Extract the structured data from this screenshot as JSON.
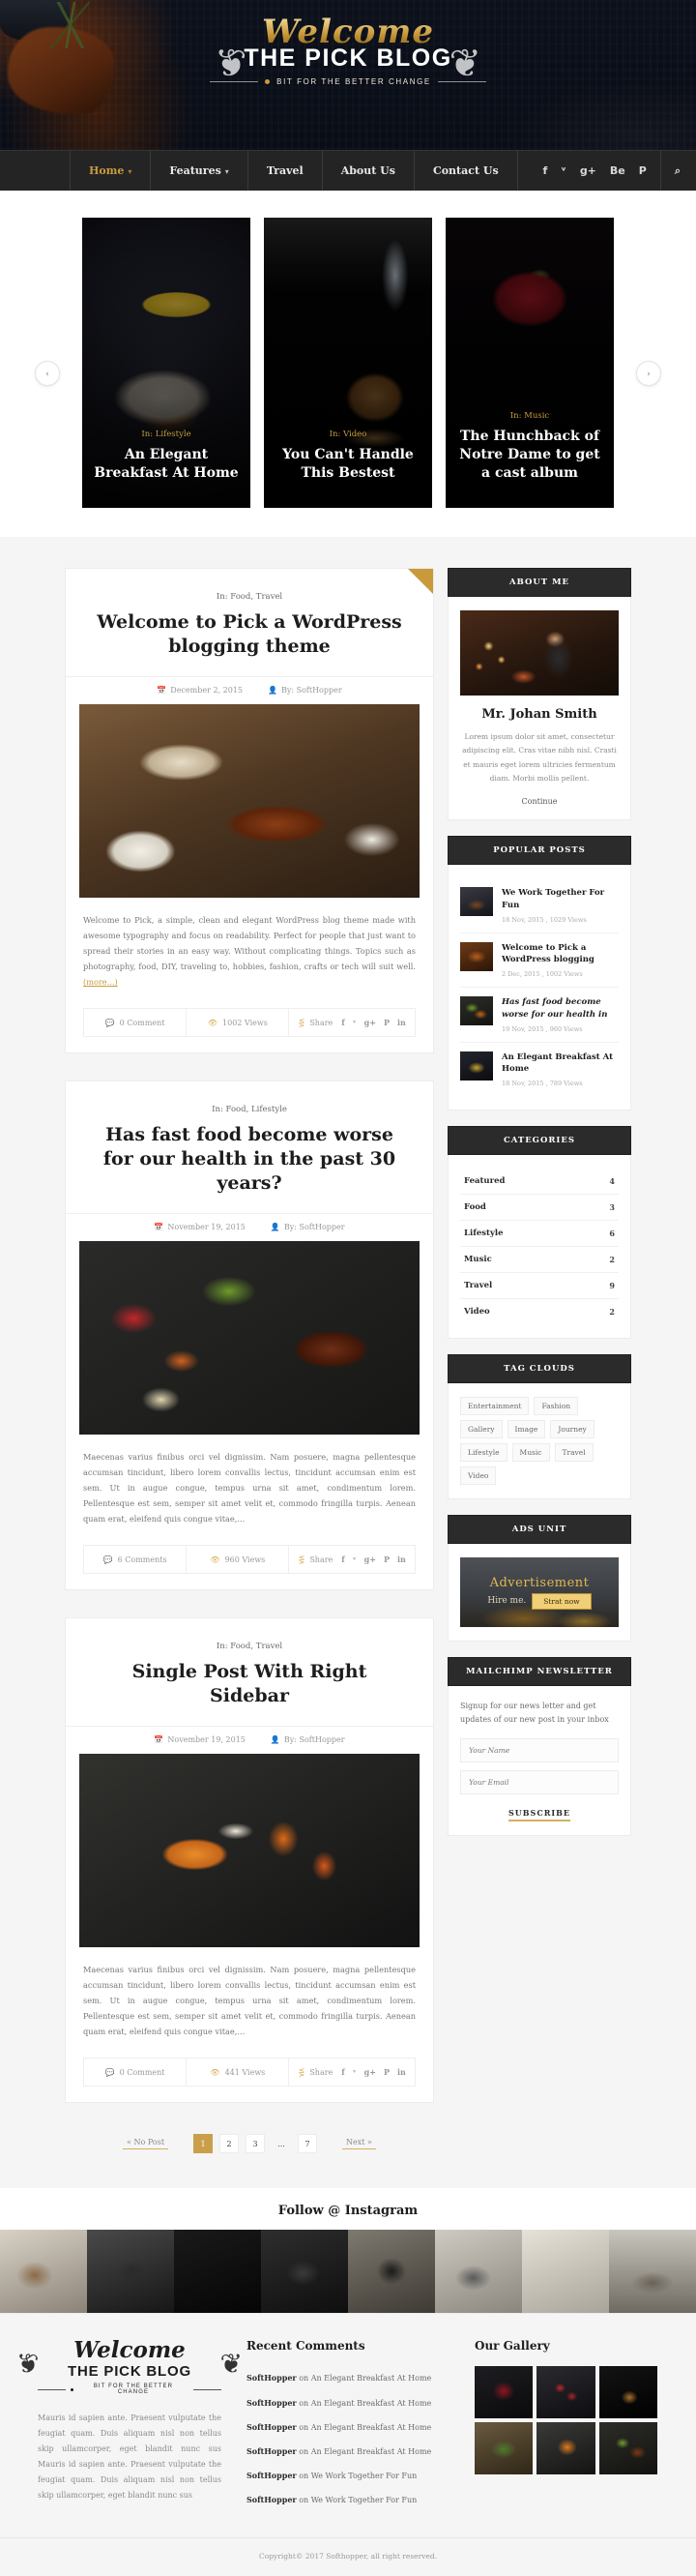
{
  "header": {
    "logo_script": "Welcome",
    "logo_main": "THE PICK BLOG",
    "logo_tagline": "BIT FOR THE BETTER CHANGE"
  },
  "nav": {
    "items": [
      {
        "label": "Home",
        "caret": "▾",
        "active": true
      },
      {
        "label": "Features",
        "caret": "▾",
        "active": false
      },
      {
        "label": "Travel",
        "caret": "",
        "active": false
      },
      {
        "label": "About Us",
        "caret": "",
        "active": false
      },
      {
        "label": "Contact Us",
        "caret": "",
        "active": false
      }
    ],
    "social": [
      {
        "name": "facebook-icon",
        "glyph": "f"
      },
      {
        "name": "twitter-icon",
        "glyph": "ᵛ"
      },
      {
        "name": "google-plus-icon",
        "glyph": "g+"
      },
      {
        "name": "behance-icon",
        "glyph": "Be"
      },
      {
        "name": "pinterest-icon",
        "glyph": "P"
      },
      {
        "name": "search-icon",
        "glyph": "⌕"
      }
    ]
  },
  "slider": {
    "prev": "‹",
    "next": "›",
    "slides": [
      {
        "category": "In: Lifestyle",
        "title": "An Elegant Breakfast At Home"
      },
      {
        "category": "In: Video",
        "title": "You Can't Handle This Bestest"
      },
      {
        "category": "In: Music",
        "title": "The Hunchback of Notre Dame to get a cast album"
      }
    ]
  },
  "posts": [
    {
      "category": "In: Food, Travel",
      "title": "Welcome to Pick a WordPress blogging theme",
      "date": "December 2, 2015",
      "author": "By: SoftHopper",
      "excerpt": "Welcome to Pick, a simple, clean and elegant WordPress blog theme made with awesome typography and focus on readability. Perfect for people that just want to spread their stories in an easy way. Without complicating things. Topics such as photography, food, DIY, traveling to, hobbies, fashion, crafts or tech will suit well.",
      "more": "(more...)",
      "comments": "0 Comment",
      "views": "1002 Views",
      "share": "Share"
    },
    {
      "category": "In: Food, Lifestyle",
      "title": "Has fast food become worse for our health in the past 30 years?",
      "date": "November 19, 2015",
      "author": "By: SoftHopper",
      "excerpt": "Maecenas varius finibus orci vel dignissim. Nam posuere, magna pellentesque accumsan tincidunt, libero lorem convallis lectus, tincidunt accumsan enim est sem. Ut in augue congue, tempus urna sit amet, condimentum lorem. Pellentesque est sem, semper sit amet velit et, commodo fringilla turpis. Aenean quam erat, eleifend quis congue vitae,...",
      "more": "",
      "comments": "6 Comments",
      "views": "960 Views",
      "share": "Share"
    },
    {
      "category": "In: Food, Travel",
      "title": "Single Post With Right Sidebar",
      "date": "November 19, 2015",
      "author": "By: SoftHopper",
      "excerpt": "Maecenas varius finibus orci vel dignissim. Nam posuere, magna pellentesque accumsan tincidunt, libero lorem convallis lectus, tincidunt accumsan enim est sem. Ut in augue congue, tempus urna sit amet, condimentum lorem. Pellentesque est sem, semper sit amet velit et, commodo fringilla turpis. Aenean quam erat, eleifend quis congue vitae,...",
      "more": "",
      "comments": "0 Comment",
      "views": "441 Views",
      "share": "Share"
    }
  ],
  "share_icons": [
    "f",
    "ᵛ",
    "g+",
    "P",
    "in"
  ],
  "sidebar": {
    "about": {
      "heading": "ABOUT ME",
      "name": "Mr. Johan Smith",
      "text": "Lorem ipsum dolor sit amet, consectetur adipiscing elit. Cras vitae nibh nisl. Crasti et mauris eget lorem ultricies fermentum diam. Morbi mollis pellent.",
      "continue": "Continue"
    },
    "popular": {
      "heading": "POPULAR POSTS",
      "items": [
        {
          "title": "We Work Together For Fun",
          "meta": "18 Nov, 2015 , 1029 Views"
        },
        {
          "title": "Welcome to Pick a WordPress blogging",
          "meta": "2 Dec, 2015 , 1002 Views"
        },
        {
          "title": "Has fast food become worse for our health in",
          "meta": "19 Nov, 2015 , 960 Views"
        },
        {
          "title": "An Elegant Breakfast At Home",
          "meta": "18 Nov, 2015 , 789 Views"
        }
      ]
    },
    "categories": {
      "heading": "CATEGORIES",
      "items": [
        {
          "label": "Featured",
          "count": "4"
        },
        {
          "label": "Food",
          "count": "3"
        },
        {
          "label": "Lifestyle",
          "count": "6"
        },
        {
          "label": "Music",
          "count": "2"
        },
        {
          "label": "Travel",
          "count": "9"
        },
        {
          "label": "Video",
          "count": "2"
        }
      ]
    },
    "tags": {
      "heading": "TAG CLOUDS",
      "items": [
        "Entertainment",
        "Fashion",
        "Gallery",
        "Image",
        "Journey",
        "Lifestyle",
        "Music",
        "Travel",
        "Video"
      ]
    },
    "ads": {
      "heading": "ADS UNIT",
      "title": "Advertisement",
      "subtitle": "Hire me.",
      "button": "Strat now"
    },
    "newsletter": {
      "heading": "MAILCHIMP NEWSLETTER",
      "text": "Signup for our news letter and get updates of our new post in your inbox",
      "name_placeholder": "Your Name",
      "email_placeholder": "Your Email",
      "button": "SUBSCRIBE"
    }
  },
  "pagination": {
    "prev": "«  No Post",
    "pages": [
      "1",
      "2",
      "3",
      "...",
      "7"
    ],
    "active": "1",
    "next": "Next »"
  },
  "instagram": {
    "heading": "Follow @ Instagram"
  },
  "footer": {
    "logo_script": "Welcome",
    "logo_main": "THE PICK BLOG",
    "logo_tagline": "BIT FOR THE BETTER CHANGE",
    "about_text": "Mauris id sapien ante. Praesent vulputate the feugiat quam. Duis aliquam nisl non tellus skip ullamcorper, eget blandit nunc sus Mauris id sapien ante. Praesent vulputate the feugiat quam. Duis aliquam nisl non tellus skip ullamcorper, eget blandit nunc sus",
    "comments_heading": "Recent Comments",
    "comments": [
      {
        "author": "SoftHopper",
        "on": "on",
        "post": "An Elegant Breakfast At Home"
      },
      {
        "author": "SoftHopper",
        "on": "on",
        "post": "An Elegant Breakfast At Home"
      },
      {
        "author": "SoftHopper",
        "on": "on",
        "post": "An Elegant Breakfast At Home"
      },
      {
        "author": "SoftHopper",
        "on": "on",
        "post": "An Elegant Breakfast At Home"
      },
      {
        "author": "SoftHopper",
        "on": "on",
        "post": "We Work Together For Fun"
      },
      {
        "author": "SoftHopper",
        "on": "on",
        "post": "We Work Together For Fun"
      }
    ],
    "gallery_heading": "Our Gallery",
    "copyright": "Copyright© 2017 Softhopper, all right reserved."
  },
  "colors": {
    "accent": "#c99a3c",
    "dark": "#242424",
    "page_bg": "#f5f5f5"
  }
}
